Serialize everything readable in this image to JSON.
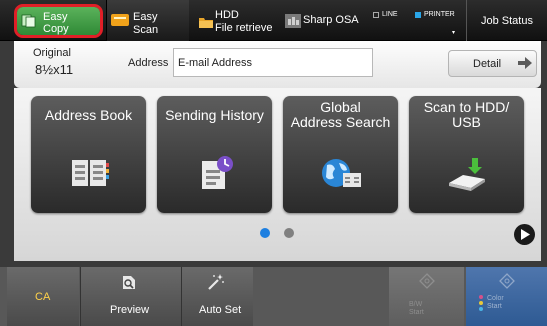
{
  "topbar": {
    "easy_copy": {
      "line1": "Easy",
      "line2": "Copy",
      "selected": true
    },
    "easy_scan": {
      "line1": "Easy",
      "line2": "Scan"
    },
    "hdd": {
      "line1": "HDD",
      "line2": "File retrieve"
    },
    "sharp_osa": {
      "label": "Sharp OSA"
    },
    "line": {
      "label": "LINE"
    },
    "printer": {
      "label": "PRINTER",
      "indicator_color": "#2aa6e8"
    },
    "job_status": {
      "label": "Job Status"
    },
    "highlight_color": "#e01f27"
  },
  "info": {
    "original_label": "Original",
    "original_value": "8½x11",
    "address_label": "Address",
    "address_value": "E-mail Address",
    "detail_label": "Detail"
  },
  "functions": [
    {
      "lines": [
        "Address Book"
      ],
      "icon": "address-book-icon"
    },
    {
      "lines": [
        "Sending History"
      ],
      "icon": "sending-history-icon"
    },
    {
      "lines": [
        "Global",
        "Address Search"
      ],
      "icon": "global-address-search-icon"
    },
    {
      "lines": [
        "Scan to HDD/",
        "USB"
      ],
      "icon": "scan-to-hdd-usb-icon"
    }
  ],
  "pagination": {
    "current": 1,
    "total": 2,
    "active_color": "#1d7fe0"
  },
  "bottombar": {
    "ca_label": "CA",
    "preview_label": "Preview",
    "autoset_label": "Auto Set",
    "bw_line1": "B/W",
    "bw_line2": "Start",
    "color_line1": "Color",
    "color_line2": "Start"
  }
}
